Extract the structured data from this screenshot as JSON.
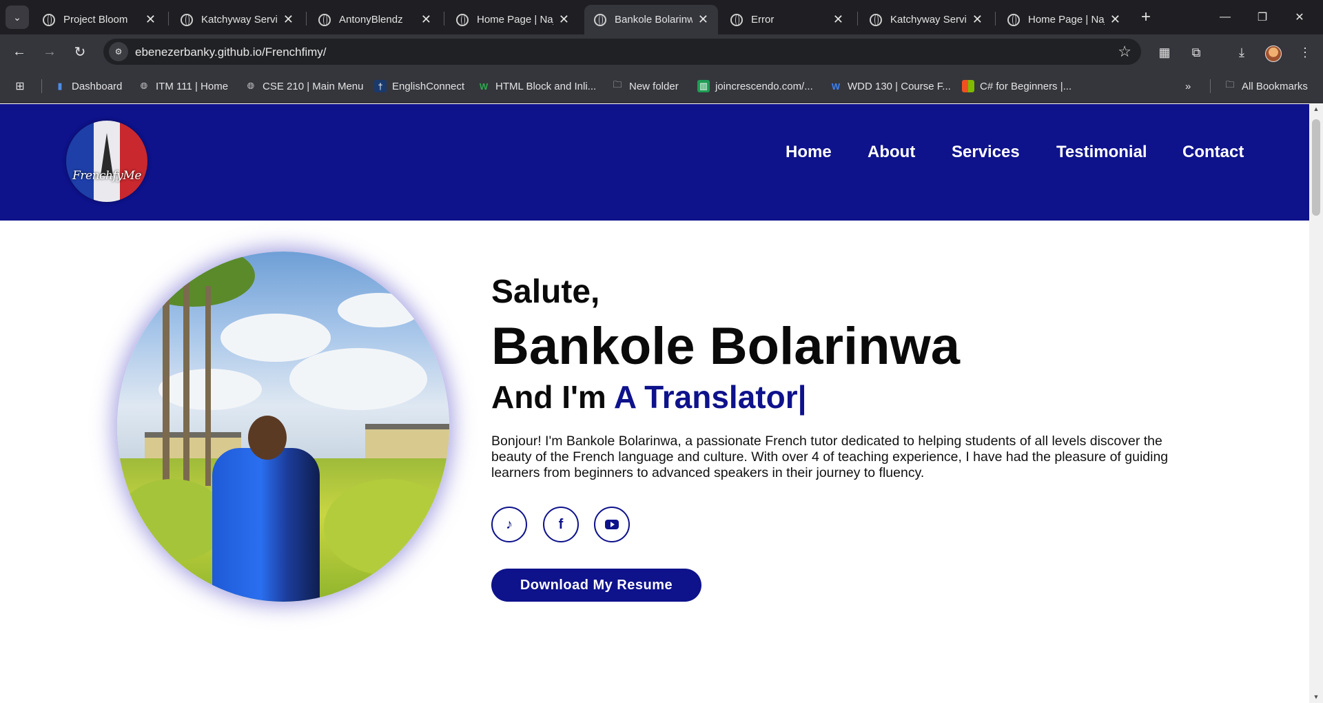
{
  "browser": {
    "tabs": [
      {
        "title": "Project Bloom",
        "active": false
      },
      {
        "title": "Katchyway Servic",
        "active": false
      },
      {
        "title": "AntonyBlendz",
        "active": false
      },
      {
        "title": "Home Page | Naj",
        "active": false
      },
      {
        "title": "Bankole Bolarinw",
        "active": true
      },
      {
        "title": "Error",
        "active": false
      },
      {
        "title": "Katchyway Servic",
        "active": false
      },
      {
        "title": "Home Page | Naj",
        "active": false
      }
    ],
    "url": "ebenezerbanky.github.io/Frenchfimy/",
    "bookmarks": [
      {
        "label": "Dashboard",
        "icon": "bar-chart-icon"
      },
      {
        "label": "ITM 111 | Home",
        "icon": "globe-icon"
      },
      {
        "label": "CSE 210 | Main Menu",
        "icon": "globe-icon"
      },
      {
        "label": "EnglishConnect",
        "icon": "temple-icon"
      },
      {
        "label": "HTML Block and Inli...",
        "icon": "w-icon"
      },
      {
        "label": "New folder",
        "icon": "folder-icon"
      },
      {
        "label": "joincrescendo.com/...",
        "icon": "sheets-icon"
      },
      {
        "label": "WDD 130 | Course F...",
        "icon": "w-icon"
      },
      {
        "label": "C# for Beginners |...",
        "icon": "microsoft-icon"
      }
    ],
    "all_bookmarks_label": "All Bookmarks"
  },
  "site": {
    "logo_text": "FrenchfyMe",
    "nav": [
      "Home",
      "About",
      "Services",
      "Testimonial",
      "Contact"
    ],
    "hero": {
      "greeting": "Salute,",
      "name": "Bankole Bolarinwa",
      "role_prefix": "And I'm ",
      "role_accent": "A Translator|",
      "bio": "Bonjour! I'm Bankole Bolarinwa, a passionate French tutor dedicated to helping students of all levels discover the beauty of the French language and culture. With over 4 of teaching experience, I have had the pleasure of guiding learners from beginners to advanced speakers in their journey to fluency.",
      "social_icons": [
        "tiktok-icon",
        "facebook-icon",
        "youtube-icon"
      ],
      "resume_button": "Download My Resume"
    },
    "colors": {
      "brand_navy": "#0e128b",
      "text": "#0a0a0a"
    }
  }
}
